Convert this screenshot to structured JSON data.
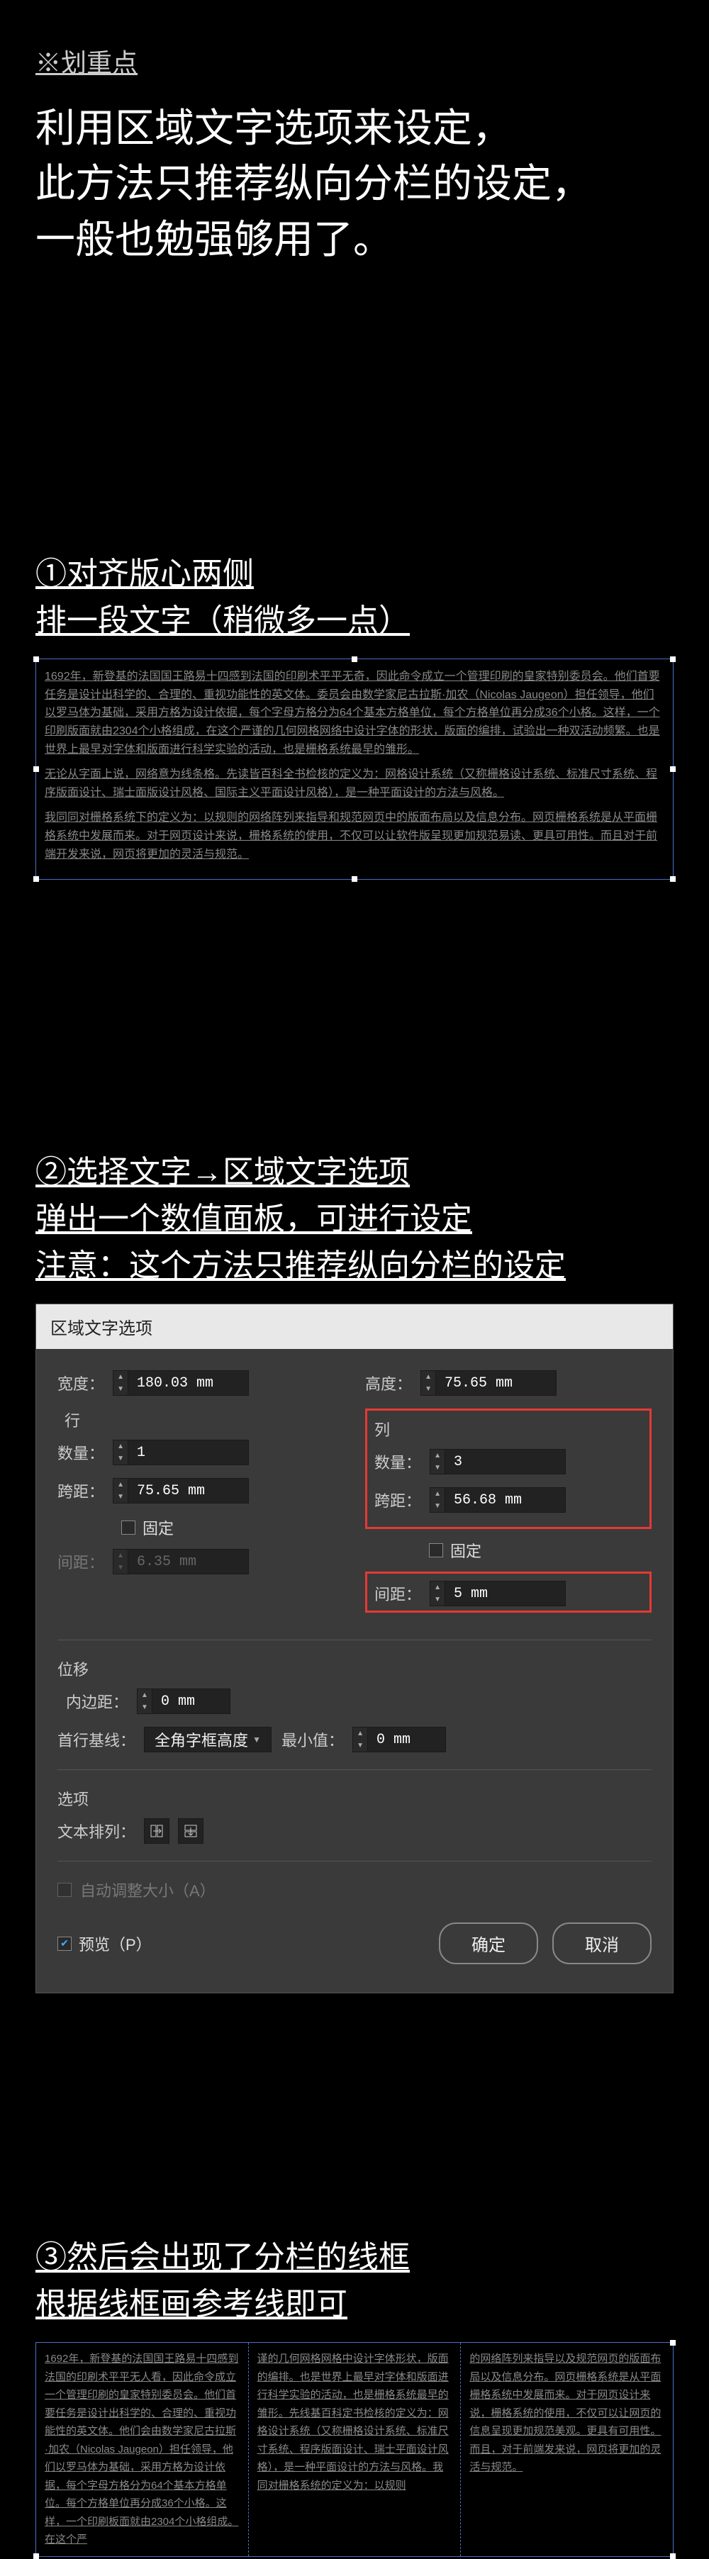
{
  "header": {
    "key_point": "※划重点",
    "desc_l1": "利用区域文字选项来设定，",
    "desc_l2": "此方法只推荐纵向分栏的设定，",
    "desc_l3": "一般也勉强够用了。"
  },
  "step1": {
    "title_l1": "①对齐版心两侧",
    "title_l2": "排一段文字（稍微多一点）",
    "body_p1": "1692年，新登基的法国国王路易十四感到法国的印刷术平平无奇，因此命令成立一个管理印刷的皇家特别委员会。他们首要任务是设计出科学的、合理的、重视功能性的英文体。委员会由数学家尼古拉斯·加农（Nicolas Jaugeon）担任领导，他们以罗马体为基础，采用方格为设计依据，每个字母方格分为64个基本方格单位，每个方格单位再分成36个小格。这样，一个印刷版面就由2304个小格组成，在这个严谨的几何网格网络中设计字体的形状，版面的编排，试验出一种双活动频繁。也是世界上最早对字体和版面进行科学实验的活动，也是栅格系统最早的雏形。",
    "body_p2": "无论从字面上说，网络意为线条格。先读皆百科全书检核的定义为：网格设计系统（又称栅格设计系统、标准尺寸系统、程序版面设计、瑞士面版设计风格、国际主义平面设计风格），是一种平面设计的方法与风格。",
    "body_p3": "我同同对栅格系统下的定义为：以规则的网络阵列来指导和规范网页中的版面布局以及信息分布。网页栅格系统是从平面栅格系统中发展而来。对于网页设计来说，栅格系统的使用，不仅可以让软件版呈现更加规范易读、更具可用性。而且对于前端开发来说，网页将更加的灵活与规范。"
  },
  "step2": {
    "title_l1": "②选择文字→区域文字选项",
    "title_l2": "弹出一个数值面板，可进行设定",
    "title_l3": "注意：这个方法只推荐纵向分栏的设定"
  },
  "dialog": {
    "title": "区域文字选项",
    "width_label": "宽度：",
    "width_value": "180.03 mm",
    "height_label": "高度：",
    "height_value": "75.65 mm",
    "rows_label": "行",
    "cols_label": "列",
    "count_label": "数量：",
    "rows_count": "1",
    "cols_count": "3",
    "span_label": "跨距：",
    "rows_span": "75.65 mm",
    "cols_span": "56.68 mm",
    "fixed_label": "固定",
    "gap_label": "间距：",
    "rows_gap": "6.35 mm",
    "cols_gap": "5 mm",
    "offset_label": "位移",
    "inset_label": "内边距：",
    "inset_value": "0 mm",
    "first_baseline_label": "首行基线：",
    "first_baseline_value": "全角字框高度",
    "min_label": "最小值：",
    "min_value": "0 mm",
    "options_label": "选项",
    "textflow_label": "文本排列：",
    "autosize_label": "自动调整大小（A）",
    "preview_label": "预览（P）",
    "ok": "确定",
    "cancel": "取消"
  },
  "step3": {
    "title_l1": "③然后会出现了分栏的线框",
    "title_l2": "根据线框画参考线即可",
    "col1": "1692年，新登基的法国国王路易十四感到法国的印刷术平平无人看，因此命令成立一个管理印刷的皇家特别委员会。他们首要任务是设计出科学的、合理的、重视功能性的英文体。他们会由数学家尼古拉斯·加农（Nicolas Jaugeon）担任领导，他们以罗马体为基础，采用方格为设计依据，每个字母方格分为64个基本方格单位。每个方格单位再分成36个小格。这样，一个印刷板面就由2304个小格组成。在这个严",
    "col2": "谨的几何网格网格中设计字体形状，版面的编排。也是世界上最早对字体和版面进行科学实验的活动，也是栅格系统最早的雏形。先线基百科定书检核的定义为：网格设计系统（又称栅格设计系统、标准尺寸系统、程序版面设计、瑞士平面设计风格），是一种平面设计的方法与风格。我同对栅格系统的定义为：以规则",
    "col3": "的网络阵列来指导以及规范网页的版面布局以及信息分布。网页栅格系统是从平面栅格系统中发展而来。对于网页设计来说，栅格系统的使用，不仅可以让网页的信息呈现更加规范美观。更具有可用性。而且，对于前端发来说，网页将更加的灵活与规范。"
  }
}
